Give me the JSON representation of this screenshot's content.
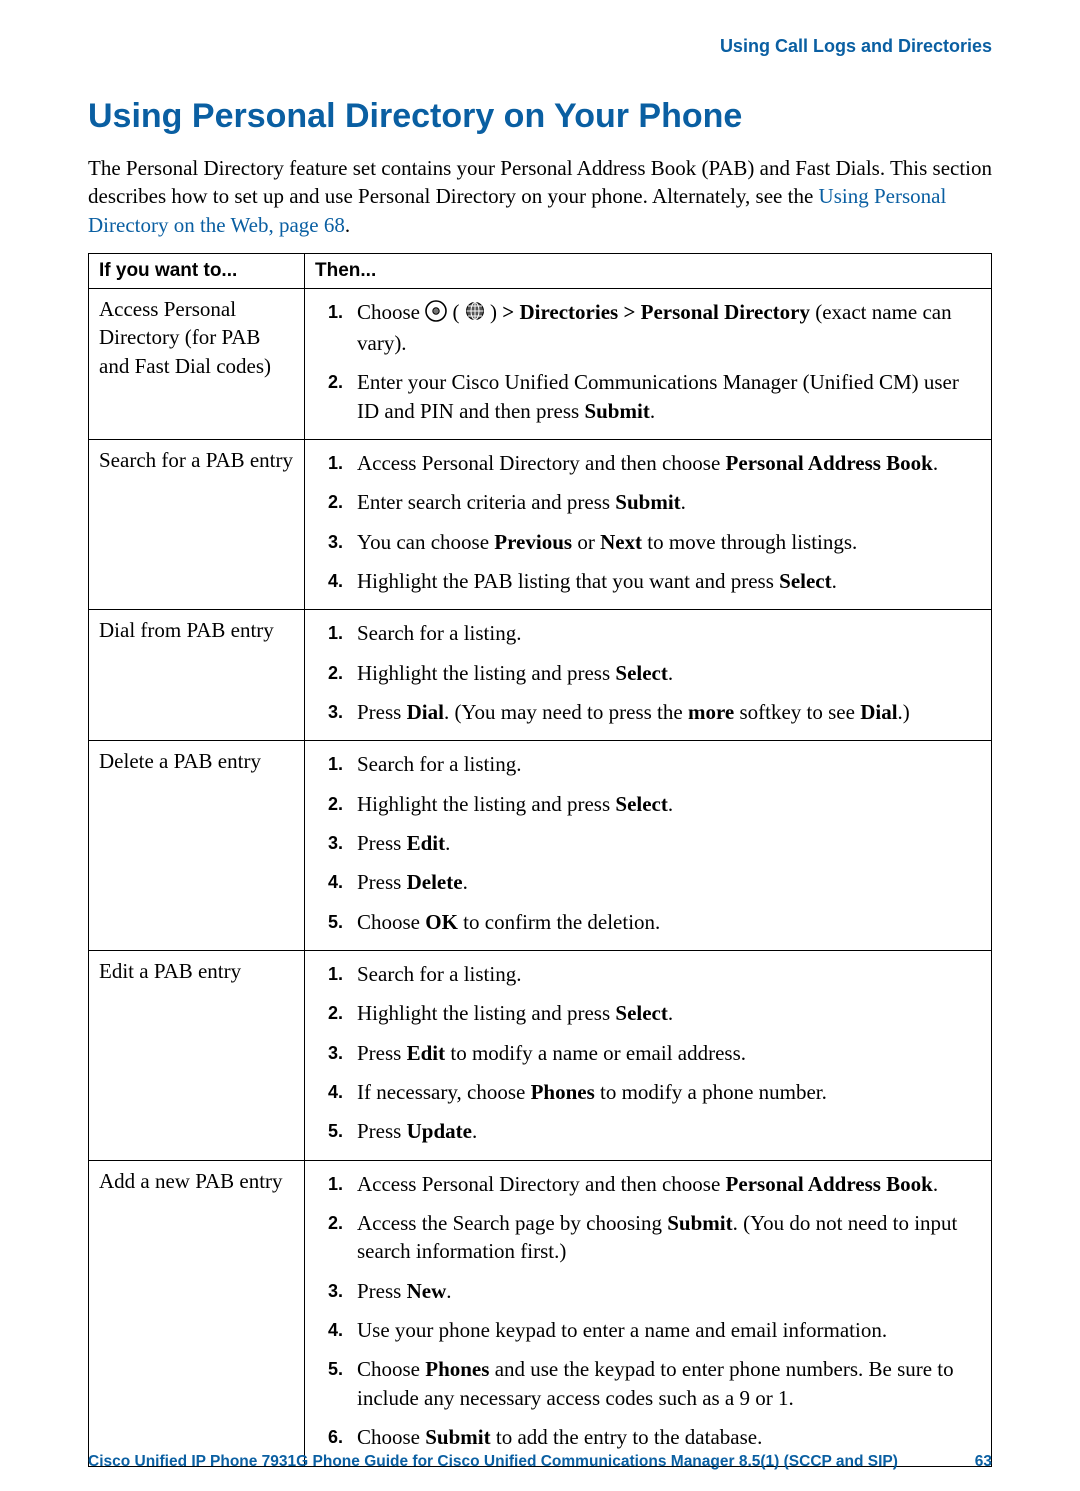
{
  "running_head": "Using Call Logs and Directories",
  "title": "Using Personal Directory on Your Phone",
  "intro": {
    "t1": "The Personal Directory feature set contains your Personal Address Book (PAB) and Fast Dials. This section describes how to set up and use Personal Directory on your phone. Alternately, see the ",
    "link": "Using Personal Directory on the Web, page 68",
    "t2": "."
  },
  "table": {
    "head_if": "If you want to...",
    "head_then": "Then...",
    "rows": [
      {
        "if": "Access Personal Directory (for PAB and Fast Dial codes)",
        "steps": [
          {
            "parts": [
              {
                "t": "Choose "
              },
              {
                "icon": "nav-circle-icon"
              },
              {
                "t": " ( "
              },
              {
                "icon": "globe-icon"
              },
              {
                "t": " ) "
              },
              {
                "b": "> Directories > Personal Directory"
              },
              {
                "t": " (exact name can vary)."
              }
            ]
          },
          {
            "parts": [
              {
                "t": "Enter your Cisco Unified Communications Manager (Unified CM) user ID and PIN and then press "
              },
              {
                "b": "Submit"
              },
              {
                "t": "."
              }
            ]
          }
        ]
      },
      {
        "if": "Search for a PAB entry",
        "steps": [
          {
            "parts": [
              {
                "t": "Access Personal Directory and then choose "
              },
              {
                "b": "Personal Address Book"
              },
              {
                "t": "."
              }
            ]
          },
          {
            "parts": [
              {
                "t": "Enter search criteria and press "
              },
              {
                "b": "Submit"
              },
              {
                "t": "."
              }
            ]
          },
          {
            "parts": [
              {
                "t": "You can choose "
              },
              {
                "b": "Previous"
              },
              {
                "t": " or "
              },
              {
                "b": "Next"
              },
              {
                "t": " to move through listings."
              }
            ]
          },
          {
            "parts": [
              {
                "t": "Highlight the PAB listing that you want and press "
              },
              {
                "b": "Select"
              },
              {
                "t": "."
              }
            ]
          }
        ]
      },
      {
        "if": "Dial from PAB entry",
        "steps": [
          {
            "parts": [
              {
                "t": "Search for a listing."
              }
            ]
          },
          {
            "parts": [
              {
                "t": "Highlight the listing and press "
              },
              {
                "b": "Select"
              },
              {
                "t": "."
              }
            ]
          },
          {
            "parts": [
              {
                "t": "Press "
              },
              {
                "b": "Dial"
              },
              {
                "t": ". (You may need to press the "
              },
              {
                "b": "more"
              },
              {
                "t": " softkey to see "
              },
              {
                "b": "Dial"
              },
              {
                "t": ".)"
              }
            ]
          }
        ]
      },
      {
        "if": "Delete a PAB entry",
        "steps": [
          {
            "parts": [
              {
                "t": "Search for a listing."
              }
            ]
          },
          {
            "parts": [
              {
                "t": "Highlight the listing and press "
              },
              {
                "b": "Select"
              },
              {
                "t": "."
              }
            ]
          },
          {
            "parts": [
              {
                "t": "Press "
              },
              {
                "b": "Edit"
              },
              {
                "t": "."
              }
            ]
          },
          {
            "parts": [
              {
                "t": "Press "
              },
              {
                "b": "Delete"
              },
              {
                "t": "."
              }
            ]
          },
          {
            "parts": [
              {
                "t": "Choose "
              },
              {
                "b": "OK"
              },
              {
                "t": " to confirm the deletion."
              }
            ]
          }
        ]
      },
      {
        "if": "Edit a PAB entry",
        "steps": [
          {
            "parts": [
              {
                "t": "Search for a listing."
              }
            ]
          },
          {
            "parts": [
              {
                "t": "Highlight the listing and press "
              },
              {
                "b": "Select"
              },
              {
                "t": "."
              }
            ]
          },
          {
            "parts": [
              {
                "t": "Press "
              },
              {
                "b": "Edit"
              },
              {
                "t": " to modify a name or email address."
              }
            ]
          },
          {
            "parts": [
              {
                "t": "If necessary, choose "
              },
              {
                "b": "Phones"
              },
              {
                "t": " to modify a phone number."
              }
            ]
          },
          {
            "parts": [
              {
                "t": "Press "
              },
              {
                "b": "Update"
              },
              {
                "t": "."
              }
            ]
          }
        ]
      },
      {
        "if": "Add a new PAB entry",
        "steps": [
          {
            "parts": [
              {
                "t": "Access Personal Directory and then choose "
              },
              {
                "b": "Personal Address Book"
              },
              {
                "t": "."
              }
            ]
          },
          {
            "parts": [
              {
                "t": "Access the Search page by choosing "
              },
              {
                "b": "Submit"
              },
              {
                "t": ". (You do not need to input search information first.)"
              }
            ]
          },
          {
            "parts": [
              {
                "t": "Press "
              },
              {
                "b": "New"
              },
              {
                "t": "."
              }
            ]
          },
          {
            "parts": [
              {
                "t": "Use your phone keypad to enter a name and email information."
              }
            ]
          },
          {
            "parts": [
              {
                "t": "Choose "
              },
              {
                "b": "Phones"
              },
              {
                "t": " and use the keypad to enter phone numbers. Be sure to include any necessary access codes such as a 9 or 1."
              }
            ]
          },
          {
            "parts": [
              {
                "t": "Choose "
              },
              {
                "b": "Submit"
              },
              {
                "t": " to add the entry to the database."
              }
            ]
          }
        ]
      }
    ]
  },
  "footer": {
    "text": "Cisco Unified IP Phone 7931G Phone Guide for Cisco Unified Communications Manager 8.5(1) (SCCP and SIP)",
    "page": "63"
  }
}
